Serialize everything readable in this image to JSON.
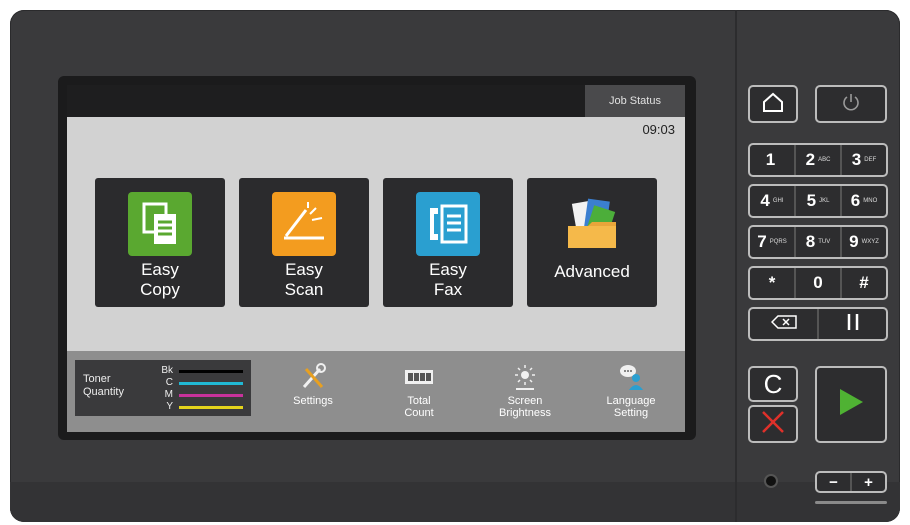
{
  "screen": {
    "job_status": "Job Status",
    "time": "09:03"
  },
  "tiles": [
    {
      "line1": "Easy",
      "line2": "Copy",
      "icon": "copy-icon",
      "color": "#5aa830"
    },
    {
      "line1": "Easy",
      "line2": "Scan",
      "icon": "scan-icon",
      "color": "#f39c1f"
    },
    {
      "line1": "Easy",
      "line2": "Fax",
      "icon": "fax-icon",
      "color": "#2a9fd0"
    },
    {
      "line1": "Advanced",
      "icon": "folder-icon"
    }
  ],
  "toner": {
    "label_line1": "Toner",
    "label_line2": "Quantity",
    "colors": [
      {
        "key": "Bk",
        "hex": "#000000"
      },
      {
        "key": "C",
        "hex": "#21b8d4"
      },
      {
        "key": "M",
        "hex": "#c8329c"
      },
      {
        "key": "Y",
        "hex": "#e4d31c"
      }
    ]
  },
  "bottom_items": [
    {
      "line1": "Settings",
      "line2": "",
      "icon": "settings-icon"
    },
    {
      "line1": "Total",
      "line2": "Count",
      "icon": "counter-icon"
    },
    {
      "line1": "Screen",
      "line2": "Brightness",
      "icon": "brightness-icon"
    },
    {
      "line1": "Language",
      "line2": "Setting",
      "icon": "language-icon"
    }
  ],
  "keypad": {
    "rows": [
      [
        {
          "d": "1",
          "s": ""
        },
        {
          "d": "2",
          "s": "ABC"
        },
        {
          "d": "3",
          "s": "DEF"
        }
      ],
      [
        {
          "d": "4",
          "s": "GHI"
        },
        {
          "d": "5",
          "s": "JKL"
        },
        {
          "d": "6",
          "s": "MNO"
        }
      ],
      [
        {
          "d": "7",
          "s": "PQRS"
        },
        {
          "d": "8",
          "s": "TUV"
        },
        {
          "d": "9",
          "s": "WXYZ"
        }
      ],
      [
        {
          "d": "*",
          "s": ""
        },
        {
          "d": "0",
          "s": ""
        },
        {
          "d": "#",
          "s": ""
        }
      ]
    ],
    "clear_label": "C",
    "minus": "−",
    "plus": "+"
  },
  "colors": {
    "start_green": "#4fb233",
    "stop_red": "#e0302a"
  }
}
